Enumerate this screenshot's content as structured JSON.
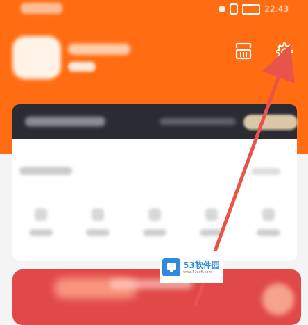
{
  "status_bar": {
    "time": "22:43"
  },
  "header": {
    "icons": [
      "scan-icon",
      "gear-icon"
    ]
  },
  "watermark": {
    "title": "53软件园",
    "subtitle": "www.53soft.com"
  },
  "colors": {
    "header_orange": "#ff6c12",
    "annotation_red": "#e8534a",
    "banner_red": "#e14848"
  }
}
